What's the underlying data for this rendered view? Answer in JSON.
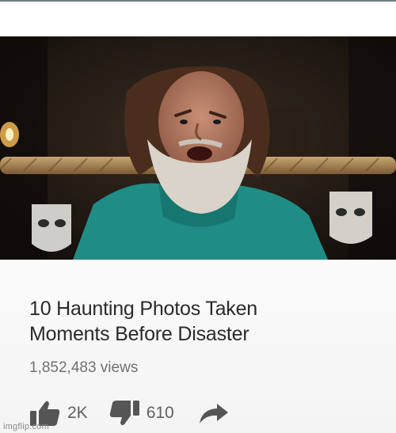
{
  "video": {
    "title_line1": "10 Haunting Photos Taken",
    "title_line2": "Moments Before Disaster",
    "views": "1,852,483 views"
  },
  "actions": {
    "like_count": "2K",
    "dislike_count": "610",
    "like_icon": "thumbs-up-icon",
    "dislike_icon": "thumbs-down-icon",
    "share_icon": "share-arrow-icon"
  },
  "watermark": "imgflip.com",
  "colors": {
    "title_text": "#2a2a2a",
    "meta_text": "#707070",
    "icon": "#555555",
    "shirt": "#1f8c86"
  }
}
